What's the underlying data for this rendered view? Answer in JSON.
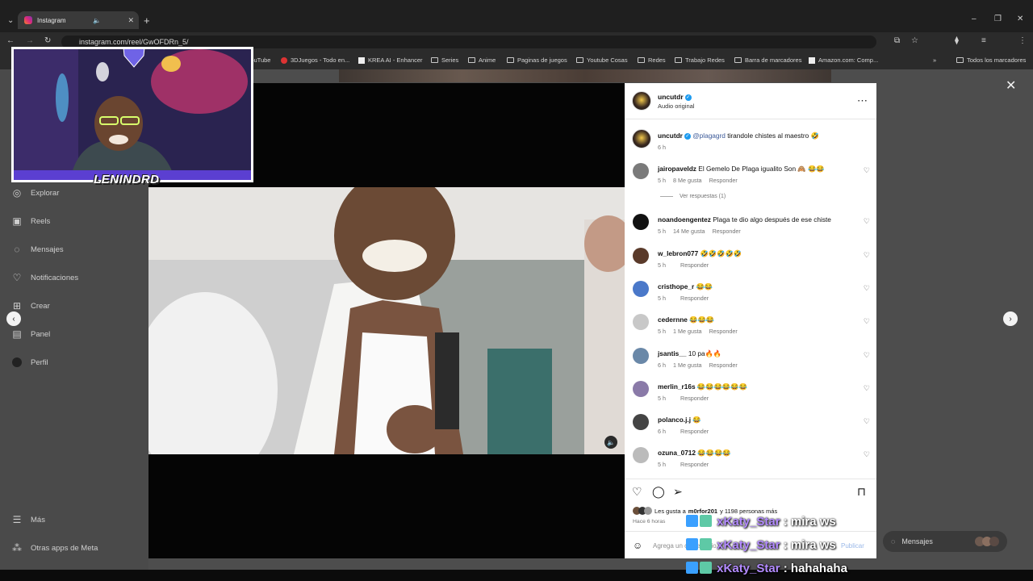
{
  "browser": {
    "tab_title": "Instagram",
    "url": "instagram.com/reel/GwOFDRn_5/",
    "bookmarks": [
      "YouTube",
      "3DJuegos - Todo en...",
      "KREA AI - Enhancer",
      "Series",
      "Anime",
      "Paginas de juegos",
      "Youtube Cosas",
      "Redes",
      "Trabajo Redes",
      "Barra de marcadores",
      "Amazon.com: Comp..."
    ],
    "all_bookmarks": "Todos los marcadores"
  },
  "sidebar": {
    "items": [
      "Explorar",
      "Reels",
      "Mensajes",
      "Notificaciones",
      "Crear",
      "Panel",
      "Perfil"
    ],
    "more": "Más",
    "meta_apps": "Otras apps de Meta"
  },
  "stream": {
    "streamer": "LENINDRD",
    "chat": [
      {
        "user": "xKaty_Star",
        "msg": "mira ws"
      },
      {
        "user": "xKaty_Star",
        "msg": "mira ws"
      },
      {
        "user": "xKaty_Star",
        "msg": "hahahaha"
      }
    ]
  },
  "post": {
    "author": "uncutdr",
    "audio": "Audio original",
    "caption_mention": "@plagagrd",
    "caption_text": "tirandole chistes al maestro 🤣",
    "caption_time": "6 h",
    "view_replies": "Ver respuestas (1)",
    "comments": [
      {
        "user": "jairopaveldz",
        "text": "El Gemelo De Plaga igualito Son 🙈 😂😂",
        "time": "5 h",
        "likes": "8 Me gusta",
        "reply": "Responder"
      },
      {
        "user": "noandoengentez",
        "text": "Plaga te dio algo después de ese chiste",
        "time": "5 h",
        "likes": "14 Me gusta",
        "reply": "Responder"
      },
      {
        "user": "w_lebron077",
        "text": "🤣🤣🤣🤣🤣",
        "time": "5 h",
        "likes": "",
        "reply": "Responder"
      },
      {
        "user": "cristhope_r",
        "text": "😂😂",
        "time": "5 h",
        "likes": "",
        "reply": "Responder"
      },
      {
        "user": "cedernne",
        "text": "😂😂😂",
        "time": "5 h",
        "likes": "1 Me gusta",
        "reply": "Responder"
      },
      {
        "user": "jsantis__",
        "text": "10 pa🔥🔥",
        "time": "6 h",
        "likes": "1 Me gusta",
        "reply": "Responder"
      },
      {
        "user": "merlin_r16s",
        "text": "😂😂😂😂😂😂",
        "time": "5 h",
        "likes": "",
        "reply": "Responder"
      },
      {
        "user": "polanco.j.j",
        "text": "😂",
        "time": "6 h",
        "likes": "",
        "reply": "Responder"
      },
      {
        "user": "ozuna_0712",
        "text": "😂😂😂😂",
        "time": "5 h",
        "likes": "",
        "reply": "Responder"
      }
    ],
    "likes_prefix": "Les gusta a",
    "likes_user": "m0rfor201",
    "likes_rest": "y 1198 personas más",
    "posted": "Hace 6 horas",
    "comment_placeholder": "Agrega un comentario...",
    "publish": "Publicar"
  },
  "messages_button": "Mensajes"
}
